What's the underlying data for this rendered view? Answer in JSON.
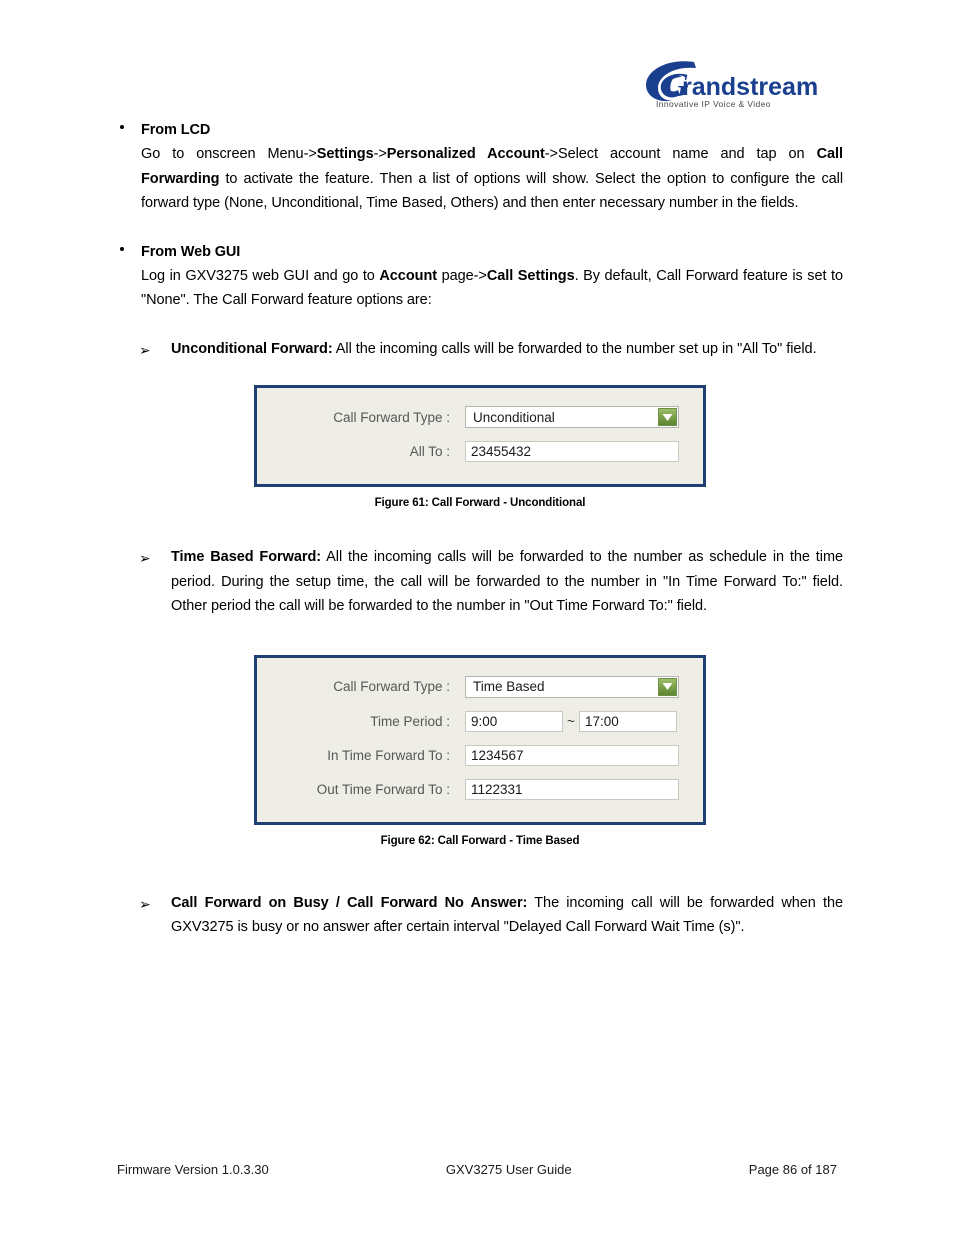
{
  "header": {
    "logo_brand": "randstream",
    "logo_mark": "G",
    "logo_tagline": "Innovative IP Voice & Video",
    "logo_color": "#1b3f8f"
  },
  "sections": {
    "lcd": {
      "title": "From LCD",
      "body_1": "Go to onscreen Menu->",
      "body_b1": "Settings",
      "body_2": "->",
      "body_b2": "Personalized Account",
      "body_3": "->Select account name and tap on ",
      "body_b3": "Call Forwarding",
      "body_4": " to activate the feature. Then a list of options will show. Select the option to configure the call forward type (None, Unconditional, Time Based, Others) and then enter necessary number in the fields."
    },
    "webgui": {
      "title": "From Web GUI",
      "body_1": "Log in GXV3275 web GUI and go to ",
      "body_b1": "Account",
      "body_2": " page->",
      "body_b2": "Call Settings",
      "body_3": ". By default, Call Forward feature is set to \"None\". The Call Forward feature options are:"
    },
    "unconditional": {
      "arrow": "➢",
      "label": "Unconditional Forward:",
      "text": " All the incoming calls will be forwarded to the number set up in \"All To\" field."
    },
    "timebased": {
      "arrow": "➢",
      "label": "Time Based Forward:",
      "text": " All the incoming calls will be forwarded to the number as schedule in the time period. During the setup time, the call will be forwarded to the number in \"In Time Forward To:\" field. Other period the call will be forwarded to the number in \"Out Time Forward To:\" field."
    },
    "busy_noanswer": {
      "arrow": "➢",
      "label": "Call Forward on Busy / Call Forward No Answer:",
      "text": " The incoming call will be forwarded when the GXV3275 is busy or no answer after certain interval \"Delayed Call Forward Wait Time (s)\"."
    }
  },
  "figure61": {
    "caption": "Figure 61: Call Forward - Unconditional",
    "rows": {
      "call_forward_type_label": "Call Forward Type :",
      "call_forward_type_value": "Unconditional",
      "all_to_label": "All To :",
      "all_to_value": "23455432"
    }
  },
  "figure62": {
    "caption": "Figure 62: Call Forward - Time Based",
    "rows": {
      "call_forward_type_label": "Call Forward Type :",
      "call_forward_type_value": "Time Based",
      "time_period_label": "Time Period :",
      "time_period_start": "9:00",
      "time_period_separator": "~",
      "time_period_end": "17:00",
      "in_time_label": "In Time Forward To :",
      "in_time_value": "1234567",
      "out_time_label": "Out Time Forward To :",
      "out_time_value": "1122331"
    }
  },
  "footer": {
    "left": "Firmware Version 1.0.3.30",
    "center": "GXV3275 User Guide",
    "right": "Page 86 of 187"
  }
}
